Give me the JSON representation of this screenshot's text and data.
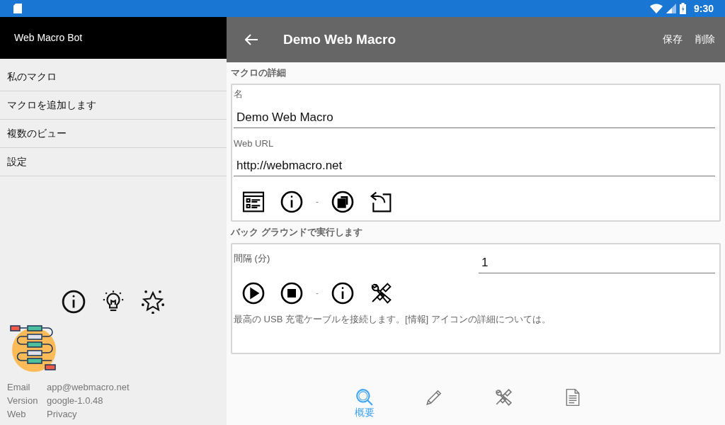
{
  "status_bar": {
    "time": "9:30"
  },
  "sidebar": {
    "title": "Web Macro Bot",
    "items": [
      {
        "label": "私のマクロ"
      },
      {
        "label": "マクロを追加します"
      },
      {
        "label": "複数のビュー"
      },
      {
        "label": "設定"
      }
    ],
    "actions": [
      {
        "kind": "info"
      },
      {
        "kind": "bulb"
      },
      {
        "kind": "star"
      }
    ],
    "about": [
      {
        "label": "Email",
        "value": "app@webmacro.net"
      },
      {
        "label": "Version",
        "value": "google-1.0.48"
      },
      {
        "label": "Web",
        "value": "Privacy"
      }
    ]
  },
  "app_bar": {
    "title": "Demo Web Macro",
    "actions": [
      "保存",
      "削除"
    ]
  },
  "details": {
    "heading": "マクロの詳細",
    "fields": [
      {
        "label": "名",
        "value": "Demo Web Macro"
      },
      {
        "label": "Web URL",
        "value": "http://webmacro.net"
      }
    ],
    "tools": [
      {
        "kind": "form"
      },
      {
        "kind": "info"
      },
      {
        "kind": "separator",
        "text": "-"
      },
      {
        "kind": "copy"
      },
      {
        "kind": "reply"
      }
    ]
  },
  "background": {
    "heading": "バック グラウンドで実行します",
    "interval_label": "間隔 (分)",
    "interval_value": "1",
    "tools": [
      {
        "kind": "play"
      },
      {
        "kind": "stop"
      },
      {
        "kind": "separator",
        "text": "-"
      },
      {
        "kind": "info"
      },
      {
        "kind": "tools"
      }
    ],
    "note": "最高の USB 充電ケーブルを接続します。[情報] アイコンの詳細については。"
  },
  "bottom_nav": [
    {
      "kind": "search",
      "label": "概要",
      "selected": true
    },
    {
      "kind": "pencil",
      "selected": false
    },
    {
      "kind": "tools",
      "selected": false
    },
    {
      "kind": "document",
      "selected": false
    }
  ]
}
